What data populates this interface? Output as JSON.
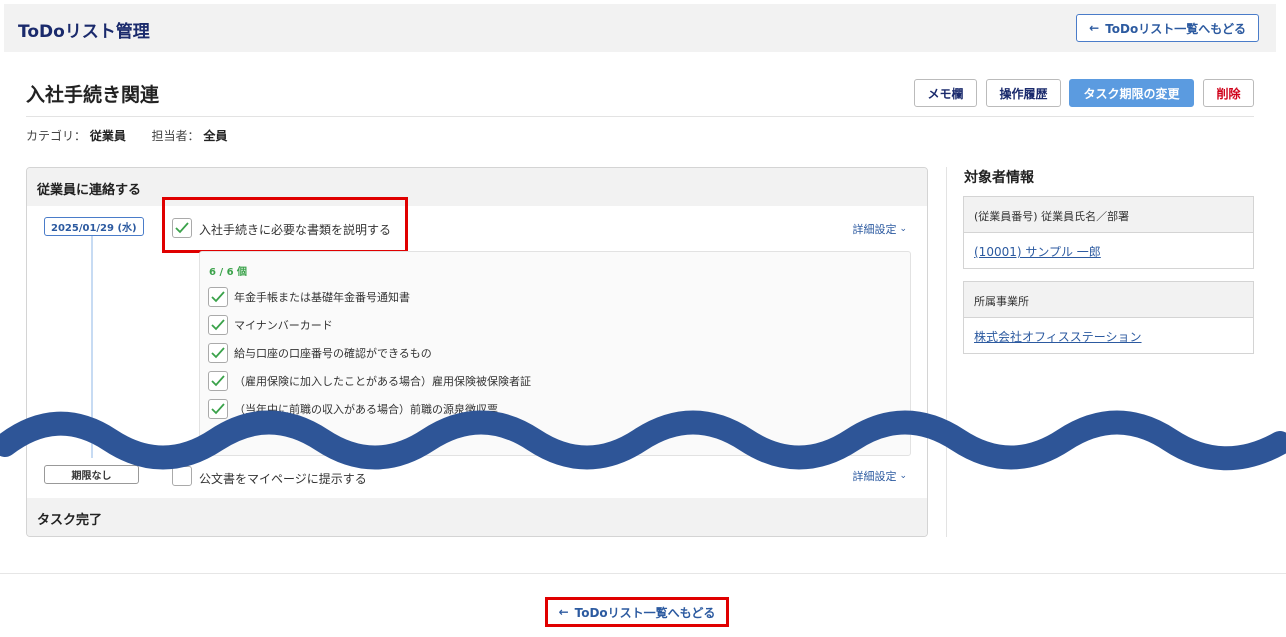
{
  "header": {
    "app_title": "ToDoリスト管理",
    "back_label": "ToDoリスト一覧へもどる"
  },
  "page": {
    "title": "入社手続き関連",
    "buttons": {
      "memo": "メモ欄",
      "history": "操作履歴",
      "change_due": "タスク期限の変更",
      "delete": "削除"
    },
    "meta": {
      "category_label": "カテゴリ：",
      "category_value": "従業員",
      "assignee_label": "担当者：",
      "assignee_value": "全員"
    }
  },
  "task_panel": {
    "title": "従業員に連絡する",
    "footer": "タスク完了",
    "task1": {
      "date": "2025/01/29 (水)",
      "label": "入社手続きに必要な書類を説明する",
      "checked": true,
      "detail_label": "詳細設定",
      "count": "6 / 6 個",
      "items": [
        "年金手帳または基礎年金番号通知書",
        "マイナンバーカード",
        "給与口座の口座番号の確認ができるもの",
        "（雇用保険に加入したことがある場合）雇用保険被保険者証",
        "（当年中に前職の収入がある場合）前職の源泉徴収票"
      ]
    },
    "task2": {
      "due": "期限なし",
      "label": "公文書をマイページに提示する",
      "checked": false,
      "detail_label": "詳細設定"
    }
  },
  "side": {
    "title": "対象者情報",
    "employee_head": "(従業員番号) 従業員氏名／部署",
    "employee_link": "(10001) サンプル 一郎",
    "office_head": "所属事業所",
    "office_link": "株式会社オフィスステーション"
  },
  "footer": {
    "back_label": "ToDoリスト一覧へもどる"
  },
  "colors": {
    "accent": "#2c5aa0",
    "primary_button": "#5b9be0",
    "danger": "#d0021b",
    "check": "#3aa24a",
    "highlight": "#e00000",
    "wave": "#2e5597"
  }
}
